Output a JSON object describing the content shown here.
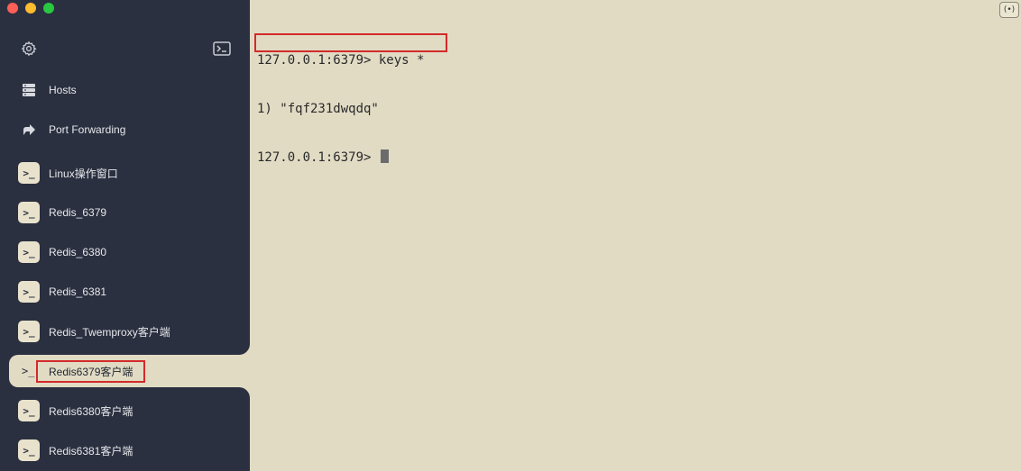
{
  "window": {
    "controls": [
      "close",
      "minimize",
      "zoom"
    ]
  },
  "sidebar": {
    "settings_icon": "gear-icon",
    "terminal_icon": "terminal-icon",
    "nav": [
      {
        "label": "Hosts",
        "icon": "hosts-grid-icon"
      },
      {
        "label": "Port Forwarding",
        "icon": "port-forward-icon"
      }
    ],
    "hosts": [
      {
        "label": "Linux操作窗口"
      },
      {
        "label": "Redis_6379"
      },
      {
        "label": "Redis_6380"
      },
      {
        "label": "Redis_6381"
      },
      {
        "label": "Redis_Twemproxy客户端"
      },
      {
        "label": "Redis6379客户端",
        "active": true
      },
      {
        "label": "Redis6380客户端"
      },
      {
        "label": "Redis6381客户端"
      }
    ],
    "host_icon_glyph": ">_"
  },
  "terminal": {
    "lines": [
      "127.0.0.1:6379> keys *",
      "1) \"fqf231dwqdq\"",
      "127.0.0.1:6379> "
    ],
    "broadcast_label": "(•)",
    "highlight_color": "#d42a2a",
    "background": "#e1dbc4"
  }
}
